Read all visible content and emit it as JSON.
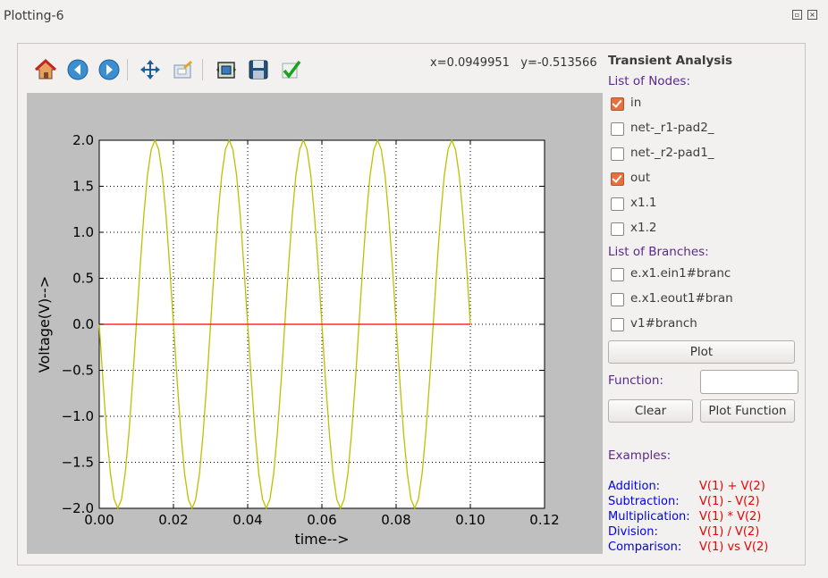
{
  "window": {
    "title": "Plotting-6"
  },
  "toolbar": {
    "icons": [
      "home-icon",
      "back-icon",
      "forward-icon",
      "pan-icon",
      "zoom-icon",
      "configure-subplots-icon",
      "save-icon",
      "apply-icon"
    ],
    "coords": "x=0.0949951   y=-0.513566"
  },
  "panel": {
    "analysis_title": "Transient Analysis",
    "nodes_heading": "List of Nodes:",
    "nodes": [
      {
        "label": "in",
        "checked": true
      },
      {
        "label": "net-_r1-pad2_",
        "checked": false
      },
      {
        "label": "net-_r2-pad1_",
        "checked": false
      },
      {
        "label": "out",
        "checked": true
      },
      {
        "label": "x1.1",
        "checked": false
      },
      {
        "label": "x1.2",
        "checked": false
      }
    ],
    "branches_heading": "List of Branches:",
    "branches": [
      {
        "label": "e.x1.ein1#branc",
        "checked": false
      },
      {
        "label": "e.x1.eout1#bran",
        "checked": false
      },
      {
        "label": "v1#branch",
        "checked": false
      }
    ],
    "plot_label": "Plot",
    "function_label": "Function:",
    "function_value": "",
    "clear_label": "Clear",
    "plot_function_label": "Plot Function",
    "examples_heading": "Examples:",
    "examples": [
      {
        "name": "Addition:",
        "expr": "V(1) + V(2)"
      },
      {
        "name": "Subtraction:",
        "expr": "V(1) - V(2)"
      },
      {
        "name": "Multiplication:",
        "expr": "V(1) * V(2)"
      },
      {
        "name": "Division:",
        "expr": "V(1) / V(2)"
      },
      {
        "name": "Comparison:",
        "expr": "V(1) vs V(2)"
      }
    ]
  },
  "colors": {
    "in_trace": "#bfbf00",
    "out_trace": "#ff0000",
    "checkbox_on": "#e8703f",
    "heading": "#5a2a8a",
    "example_name": "#0000ee",
    "example_expr": "#ee0000"
  },
  "chart_data": {
    "type": "line",
    "xlabel": "time-->",
    "ylabel": "Voltage(V)-->",
    "xlim": [
      0,
      0.12
    ],
    "ylim": [
      -2.0,
      2.0
    ],
    "xticks": [
      "0.00",
      "0.02",
      "0.04",
      "0.06",
      "0.08",
      "0.10",
      "0.12"
    ],
    "yticks": [
      "2.0",
      "1.5",
      "1.0",
      "0.5",
      "0.0",
      "−0.5",
      "−1.0",
      "−1.5",
      "−2.0"
    ],
    "grid": true,
    "series": [
      {
        "name": "in",
        "color": "#bfbf00",
        "x": [
          0,
          0.001,
          0.002,
          0.003,
          0.004,
          0.005,
          0.006,
          0.007,
          0.008,
          0.009,
          0.01,
          0.011,
          0.012,
          0.013,
          0.014,
          0.015,
          0.016,
          0.017,
          0.018,
          0.019,
          0.02,
          0.021,
          0.022,
          0.023,
          0.024,
          0.025,
          0.026,
          0.027,
          0.028,
          0.029,
          0.03,
          0.031,
          0.032,
          0.033,
          0.034,
          0.035,
          0.036,
          0.037,
          0.038,
          0.039,
          0.04,
          0.041,
          0.042,
          0.043,
          0.044,
          0.045,
          0.046,
          0.047,
          0.048,
          0.049,
          0.05,
          0.051,
          0.052,
          0.053,
          0.054,
          0.055,
          0.056,
          0.057,
          0.058,
          0.059,
          0.06,
          0.061,
          0.062,
          0.063,
          0.064,
          0.065,
          0.066,
          0.067,
          0.068,
          0.069,
          0.07,
          0.071,
          0.072,
          0.073,
          0.074,
          0.075,
          0.076,
          0.077,
          0.078,
          0.079,
          0.08,
          0.081,
          0.082,
          0.083,
          0.084,
          0.085,
          0.086,
          0.087,
          0.088,
          0.089,
          0.09,
          0.091,
          0.092,
          0.093,
          0.094,
          0.095,
          0.096,
          0.097,
          0.098,
          0.099,
          0.1
        ],
        "y": [
          0,
          -0.62,
          -1.18,
          -1.62,
          -1.9,
          -2.0,
          -1.9,
          -1.62,
          -1.18,
          -0.62,
          0,
          0.62,
          1.18,
          1.62,
          1.9,
          2.0,
          1.9,
          1.62,
          1.18,
          0.62,
          0,
          -0.62,
          -1.18,
          -1.62,
          -1.9,
          -2.0,
          -1.9,
          -1.62,
          -1.18,
          -0.62,
          0,
          0.62,
          1.18,
          1.62,
          1.9,
          2.0,
          1.9,
          1.62,
          1.18,
          0.62,
          0,
          -0.62,
          -1.18,
          -1.62,
          -1.9,
          -2.0,
          -1.9,
          -1.62,
          -1.18,
          -0.62,
          0,
          0.62,
          1.18,
          1.62,
          1.9,
          2.0,
          1.9,
          1.62,
          1.18,
          0.62,
          0,
          -0.62,
          -1.18,
          -1.62,
          -1.9,
          -2.0,
          -1.9,
          -1.62,
          -1.18,
          -0.62,
          0,
          0.62,
          1.18,
          1.62,
          1.9,
          2.0,
          1.9,
          1.62,
          1.18,
          0.62,
          0,
          -0.62,
          -1.18,
          -1.62,
          -1.9,
          -2.0,
          -1.9,
          -1.62,
          -1.18,
          -0.62,
          0,
          0.62,
          1.18,
          1.62,
          1.9,
          2.0,
          1.9,
          1.62,
          1.18,
          0.62,
          0
        ]
      },
      {
        "name": "out",
        "color": "#ff0000",
        "x": [
          0,
          0.1
        ],
        "y": [
          0,
          0
        ]
      }
    ]
  }
}
